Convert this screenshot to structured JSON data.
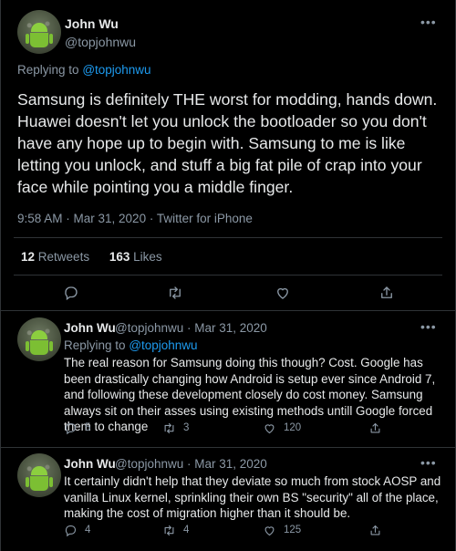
{
  "main_tweet": {
    "author_name": "John Wu",
    "author_handle": "@topjohnwu",
    "replying_label": "Replying to",
    "replying_handle": "@topjohnwu",
    "text": "Samsung is definitely THE worst for modding, hands down. Huawei doesn't let you unlock the bootloader so you don't have any hope up to begin with. Samsung to me is like letting you unlock, and stuff a big fat pile of crap into your face while pointing you a middle finger.",
    "timestamp": "9:58 AM · Mar 31, 2020 · Twitter for iPhone",
    "retweets_count": "12",
    "retweets_label": "Retweets",
    "likes_count": "163",
    "likes_label": "Likes",
    "more_icon": "•••"
  },
  "replies": [
    {
      "author_name": "John Wu",
      "author_handle_date": "@topjohnwu · Mar 31, 2020",
      "replying_label": "Replying to",
      "replying_handle": "@topjohnwu",
      "text": "The real reason for Samsung doing this though? Cost. Google has been drastically changing how Android is setup ever since Android 7, and following these development closely do cost money. Samsung always sit on their asses using existing methods untill Google forced them to change",
      "reply_count": "5",
      "retweet_count": "3",
      "like_count": "120",
      "more_icon": "•••"
    },
    {
      "author_name": "John Wu",
      "author_handle_date": "@topjohnwu · Mar 31, 2020",
      "text": "It certainly didn't help that they deviate so much from stock AOSP and vanilla Linux kernel, sprinkling their own BS \"security\" all of the place, making the cost of migration higher than it should be.",
      "reply_count": "4",
      "retweet_count": "4",
      "like_count": "125",
      "more_icon": "•••"
    }
  ],
  "colors": {
    "background": "#000000",
    "text": "#e7e9ea",
    "secondary_text": "#8b98a5",
    "link": "#1d9bf0",
    "divider": "#2f3336"
  },
  "icons": [
    "reply-icon",
    "retweet-icon",
    "like-icon",
    "share-icon",
    "more-icon",
    "android-avatar"
  ]
}
